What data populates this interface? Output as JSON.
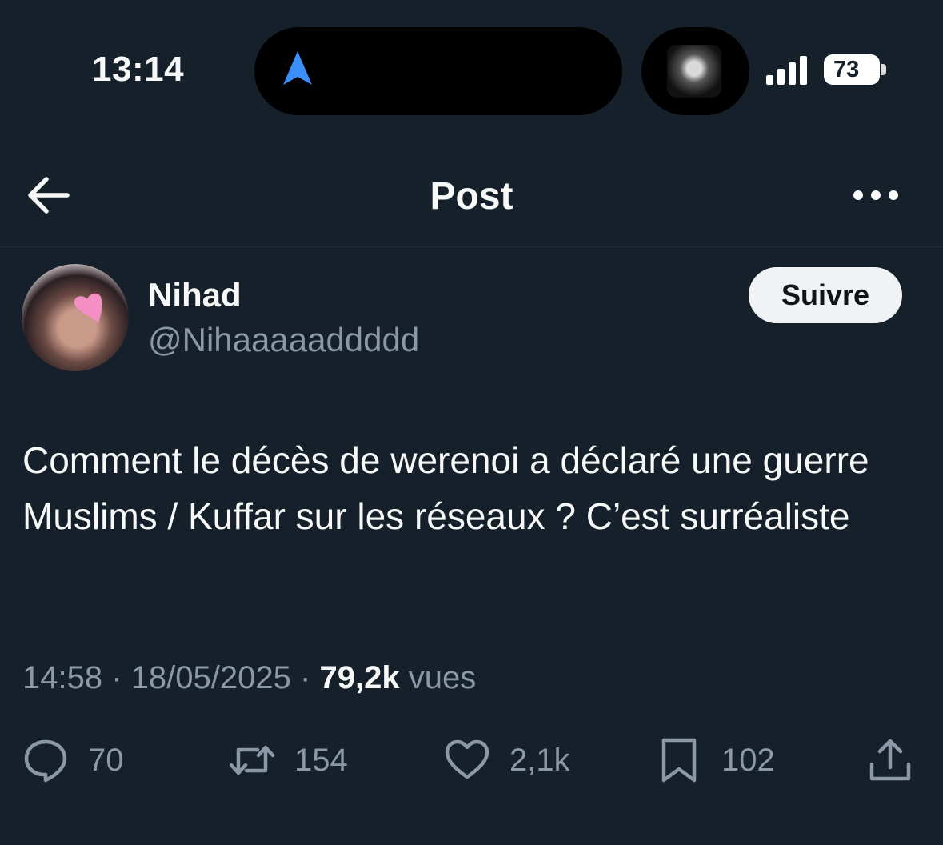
{
  "status_bar": {
    "time": "13:14",
    "battery": "73"
  },
  "header": {
    "title": "Post"
  },
  "author": {
    "name": "Nihad",
    "handle": "@Nihaaaaaddddd",
    "follow_label": "Suivre"
  },
  "post": {
    "text": "Comment le décès de werenoi a déclaré une guerre Muslims / Kuffar sur les réseaux ? C’est surréaliste",
    "time": "14:58",
    "date": "18/05/2025",
    "views": "79,2k",
    "views_label": "vues",
    "separator": "·"
  },
  "actions": {
    "replies": "70",
    "reposts": "154",
    "likes": "2,1k",
    "bookmarks": "102"
  },
  "icons": [
    "navigation-arrow-icon",
    "signal-icon",
    "battery-icon",
    "back-arrow-icon",
    "more-icon",
    "reply-icon",
    "repost-icon",
    "like-icon",
    "bookmark-icon",
    "share-icon"
  ],
  "colors": {
    "background": "#15202b",
    "text": "#f7f9f9",
    "secondary": "#8b98a5",
    "accent_nav": "#3b8ef8"
  }
}
